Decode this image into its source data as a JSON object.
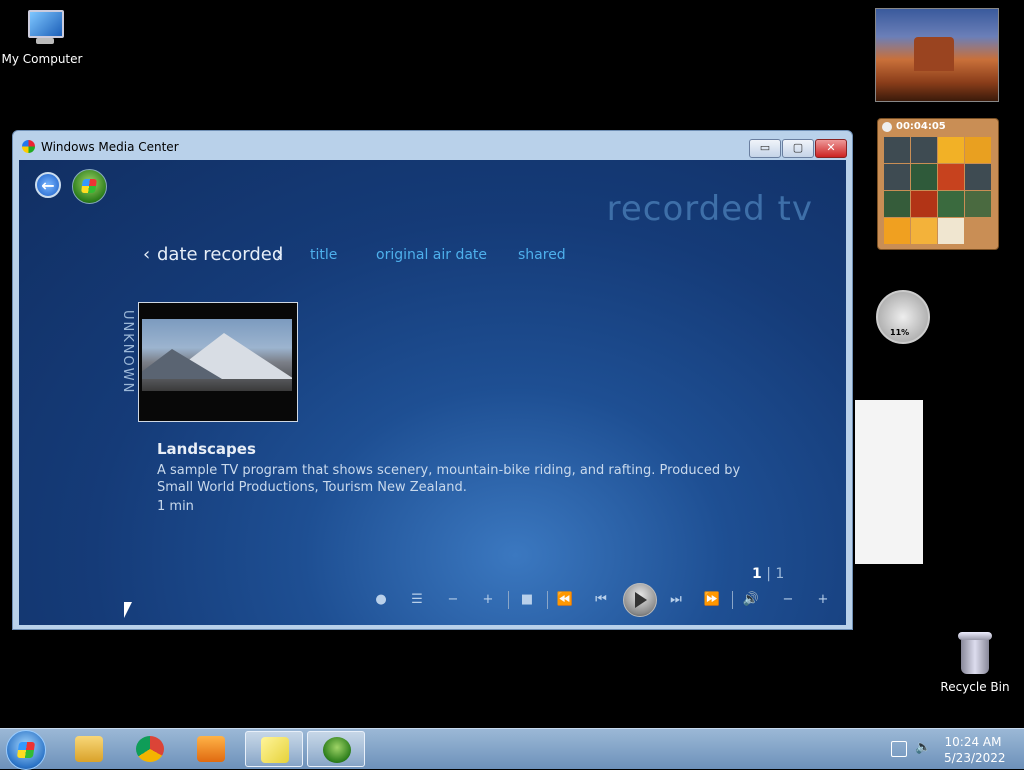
{
  "desktop": {
    "icons": {
      "my_computer": "My Computer",
      "recycle_bin": "Recycle Bin"
    },
    "puzzle_gadget": {
      "timer": "00:04:05"
    },
    "meter_gadget": {
      "value": "11%"
    }
  },
  "window": {
    "title": "Windows Media Center",
    "controls": {
      "minimize": "▭",
      "maximize": "▢",
      "close": "✕"
    },
    "page_title": "recorded tv",
    "sort_tabs": {
      "active": "date recorded",
      "prev": "‹",
      "next": "›",
      "items": [
        "title",
        "original air date",
        "shared"
      ]
    },
    "group_label": "UNKNOWN",
    "program": {
      "title": "Landscapes",
      "description": "A sample TV program that shows scenery, mountain-bike riding, and rafting. Produced by Small World Productions, Tourism New Zealand.",
      "duration": "1 min"
    },
    "pager": {
      "current": "1",
      "separator": "|",
      "total": "1"
    },
    "transport": {
      "record": "●",
      "list": "☰",
      "ch_down": "−",
      "ch_up": "+",
      "stop": "■",
      "rewind": "⏪",
      "prev": "⏮",
      "next": "⏭",
      "ffwd": "⏩",
      "mute": "🔊",
      "vol_down": "−",
      "vol_up": "+"
    }
  },
  "taskbar": {
    "clock": {
      "time": "10:24 AM",
      "date": "5/23/2022"
    },
    "apps": [
      "file-explorer",
      "chrome",
      "media-player",
      "sticky-notes",
      "media-center"
    ]
  },
  "colors": {
    "wmc_background": "#1e4f93",
    "tab_inactive": "#4eb0ec",
    "taskbar": "#7f9fc4"
  }
}
